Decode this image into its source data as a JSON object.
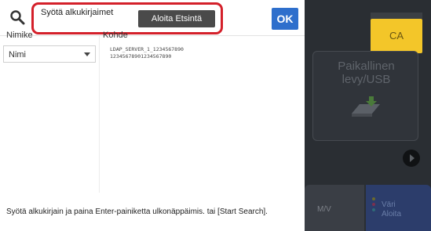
{
  "search": {
    "input_text": "Syötä alkukirjaimet",
    "start_button": "Aloita Etsintä",
    "ok_button": "OK"
  },
  "list": {
    "header_name": "Nimike",
    "header_target": "Kohde",
    "select_value": "Nimi",
    "server_line1": "LDAP_SERVER_1_1234567890",
    "server_line2": "12345678901234567890"
  },
  "hint": "Syötä alkukirjain ja paina Enter-painiketta ulkonäppäimis. tai [Start Search].",
  "background": {
    "ca_button": "CA",
    "local_drive_label": "Paikallinen levy/USB",
    "mono_label": "M/V",
    "color_start_line1": "Väri",
    "color_start_line2": "Aloita"
  },
  "colors": {
    "highlight": "#d4202a",
    "ok_button": "#2e6fcc",
    "ca_button": "#f3c629"
  },
  "icons": [
    "search-icon",
    "dropdown-arrow-icon",
    "local-drive-icon",
    "forward-arrow-icon"
  ]
}
